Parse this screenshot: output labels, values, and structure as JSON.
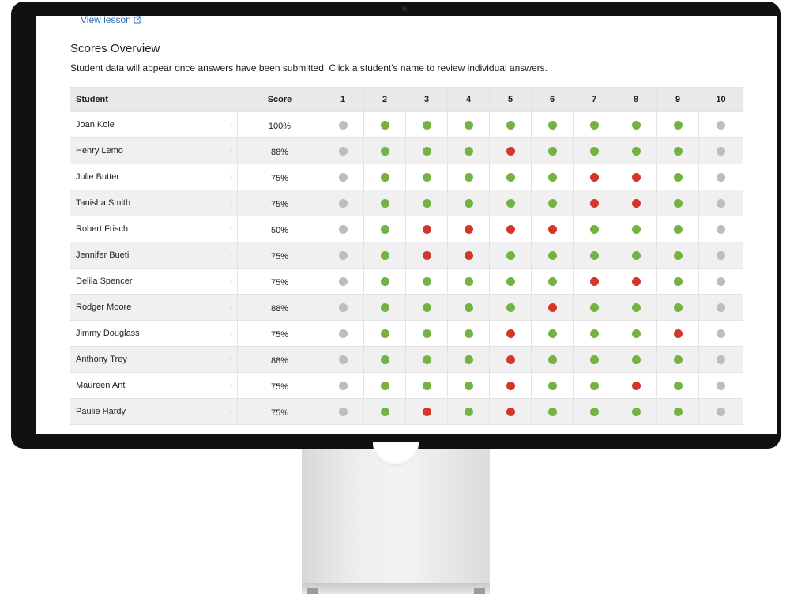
{
  "lesson_link": {
    "label": "View lesson"
  },
  "section_title": "Scores Overview",
  "description": "Student data will appear once answers have been submitted. Click a student's name to review individual answers.",
  "table": {
    "headers": [
      "Student",
      "Score",
      "1",
      "2",
      "3",
      "4",
      "5",
      "6",
      "7",
      "8",
      "9",
      "10"
    ],
    "rows": [
      {
        "name": "Joan Kole",
        "score": "100%",
        "answers": [
          "n",
          "g",
          "g",
          "g",
          "g",
          "g",
          "g",
          "g",
          "g",
          "n"
        ]
      },
      {
        "name": "Henry Lemo",
        "score": "88%",
        "answers": [
          "n",
          "g",
          "g",
          "g",
          "r",
          "g",
          "g",
          "g",
          "g",
          "n"
        ]
      },
      {
        "name": "Julie Butter",
        "score": "75%",
        "answers": [
          "n",
          "g",
          "g",
          "g",
          "g",
          "g",
          "r",
          "r",
          "g",
          "n"
        ]
      },
      {
        "name": "Tanisha Smith",
        "score": "75%",
        "answers": [
          "n",
          "g",
          "g",
          "g",
          "g",
          "g",
          "r",
          "r",
          "g",
          "n"
        ]
      },
      {
        "name": "Robert Frisch",
        "score": "50%",
        "answers": [
          "n",
          "g",
          "r",
          "r",
          "r",
          "r",
          "g",
          "g",
          "g",
          "n"
        ]
      },
      {
        "name": "Jennifer Bueti",
        "score": "75%",
        "answers": [
          "n",
          "g",
          "r",
          "r",
          "g",
          "g",
          "g",
          "g",
          "g",
          "n"
        ]
      },
      {
        "name": "Delila Spencer",
        "score": "75%",
        "answers": [
          "n",
          "g",
          "g",
          "g",
          "g",
          "g",
          "r",
          "r",
          "g",
          "n"
        ]
      },
      {
        "name": "Rodger Moore",
        "score": "88%",
        "answers": [
          "n",
          "g",
          "g",
          "g",
          "g",
          "r",
          "g",
          "g",
          "g",
          "n"
        ]
      },
      {
        "name": "Jimmy Douglass",
        "score": "75%",
        "answers": [
          "n",
          "g",
          "g",
          "g",
          "r",
          "g",
          "g",
          "g",
          "r",
          "n"
        ]
      },
      {
        "name": "Anthony Trey",
        "score": "88%",
        "answers": [
          "n",
          "g",
          "g",
          "g",
          "r",
          "g",
          "g",
          "g",
          "g",
          "n"
        ]
      },
      {
        "name": "Maureen Ant",
        "score": "75%",
        "answers": [
          "n",
          "g",
          "g",
          "g",
          "r",
          "g",
          "g",
          "r",
          "g",
          "n"
        ]
      },
      {
        "name": "Paulie Hardy",
        "score": "75%",
        "answers": [
          "n",
          "g",
          "r",
          "g",
          "r",
          "g",
          "g",
          "g",
          "g",
          "n"
        ]
      }
    ]
  },
  "status_legend": {
    "g": "correct",
    "r": "incorrect",
    "n": "not-answered"
  },
  "colors": {
    "correct": "#73b243",
    "incorrect": "#d2372a",
    "not_answered": "#bdbdbd",
    "link": "#2d6db5"
  }
}
